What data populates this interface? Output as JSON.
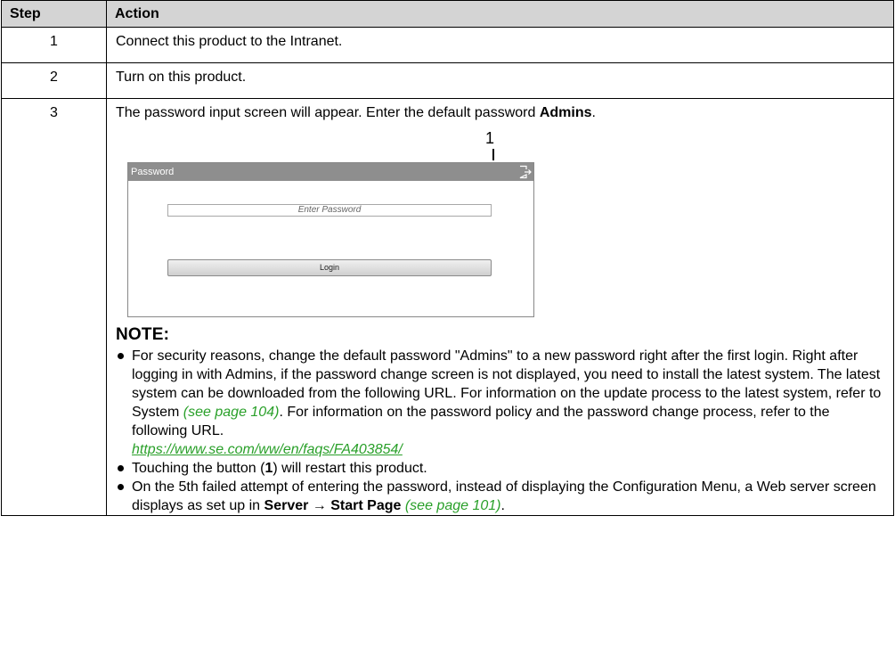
{
  "table": {
    "headers": {
      "step": "Step",
      "action": "Action"
    },
    "rows": [
      {
        "step": "1",
        "action": "Connect this product to the Intranet."
      },
      {
        "step": "2",
        "action": "Turn on this product."
      },
      {
        "step": "3",
        "intro_text": "The password input screen will appear. Enter the default password ",
        "intro_bold": "Admins",
        "intro_end": "."
      }
    ]
  },
  "screen": {
    "callout": "1",
    "title": "Password",
    "exit_icon": "exit-door-icon",
    "input_placeholder": "Enter Password",
    "login_label": "Login"
  },
  "note": {
    "title": "NOTE:",
    "b1_text": "For security reasons, change the default password \"Admins\" to a new password right after the first login. Right after logging in with Admins, if the password change screen is not displayed, you need to install the latest system. The latest system can be downloaded from the following URL. For information on the update process to the latest system, refer to System ",
    "b1_link1": "(see page 104)",
    "b1_mid": ". For information on the password policy and the password change process, refer to the following URL.",
    "b1_url": "https://www.se.com/ww/en/faqs/FA403854/",
    "b2_pre": "Touching the button (",
    "b2_bold": "1",
    "b2_post": ") will restart this product.",
    "b3_pre": "On the 5th failed attempt of entering the password, instead of displaying the Configuration Menu, a Web server screen displays as set up in ",
    "b3_bold": "Server → Start Page",
    "b3_space": " ",
    "b3_link": "(see page 101)",
    "b3_end": "."
  },
  "colors": {
    "header_bg": "#d4d4d4",
    "link": "#2aa02a",
    "titlebar": "#8e8e8e"
  }
}
